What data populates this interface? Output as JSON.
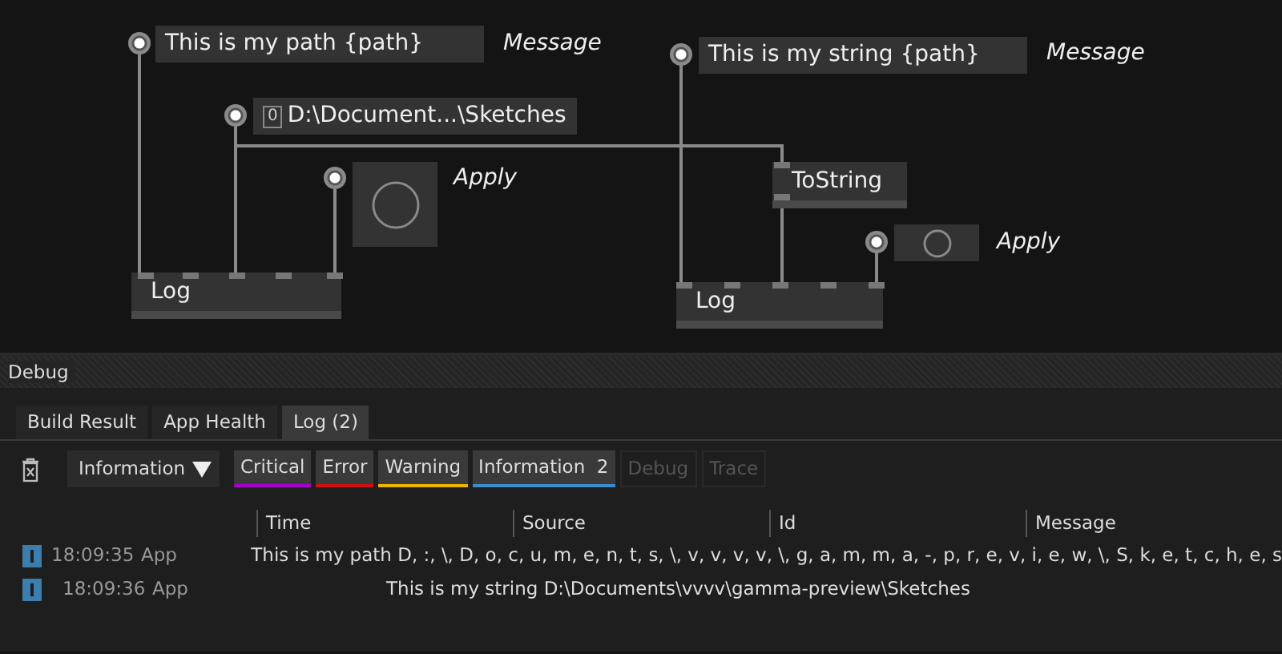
{
  "canvas": {
    "nodes": [
      {
        "kind": "iobox",
        "text": "This is my path {path}",
        "label": "Message"
      },
      {
        "kind": "path",
        "badge": "0",
        "text": "D:\\Document...\\Sketches"
      },
      {
        "kind": "bang",
        "label": "Apply"
      },
      {
        "kind": "node",
        "text": "Log"
      },
      {
        "kind": "iobox",
        "text": "This is my string {path}",
        "label": "Message"
      },
      {
        "kind": "node",
        "text": "ToString"
      },
      {
        "kind": "bang",
        "label": "Apply"
      },
      {
        "kind": "node",
        "text": "Log"
      }
    ]
  },
  "panel": {
    "title": "Debug",
    "tabs": [
      {
        "label": "Build Result",
        "selected": false
      },
      {
        "label": "App Health",
        "selected": false
      },
      {
        "label": "Log (2)",
        "selected": true
      }
    ],
    "level_dropdown": {
      "value": "Information"
    },
    "filters": [
      {
        "label": "Critical",
        "enabled": true,
        "color": "#a000c8"
      },
      {
        "label": "Error",
        "enabled": true,
        "color": "#d01010"
      },
      {
        "label": "Warning",
        "enabled": true,
        "color": "#e8b800"
      },
      {
        "label": "Information",
        "count": "2",
        "enabled": true,
        "color": "#3a8ccc"
      },
      {
        "label": "Debug",
        "enabled": false
      },
      {
        "label": "Trace",
        "enabled": false
      }
    ],
    "log": {
      "columns": [
        "Time",
        "Source",
        "Id",
        "Message"
      ],
      "rows": [
        {
          "time": "18:09:35",
          "source": "App",
          "message": "This is my path D, :, \\, D, o, c, u, m, e, n, t, s, \\, v, v, v, v, \\, g, a, m, m, a, -, p, r, e, v, i, e, w, \\, S, k, e, t, c, h, e, s"
        },
        {
          "time": "18:09:36",
          "source": "App",
          "message": "This is my string D:\\Documents\\vvvv\\gamma-preview\\Sketches"
        }
      ]
    }
  }
}
